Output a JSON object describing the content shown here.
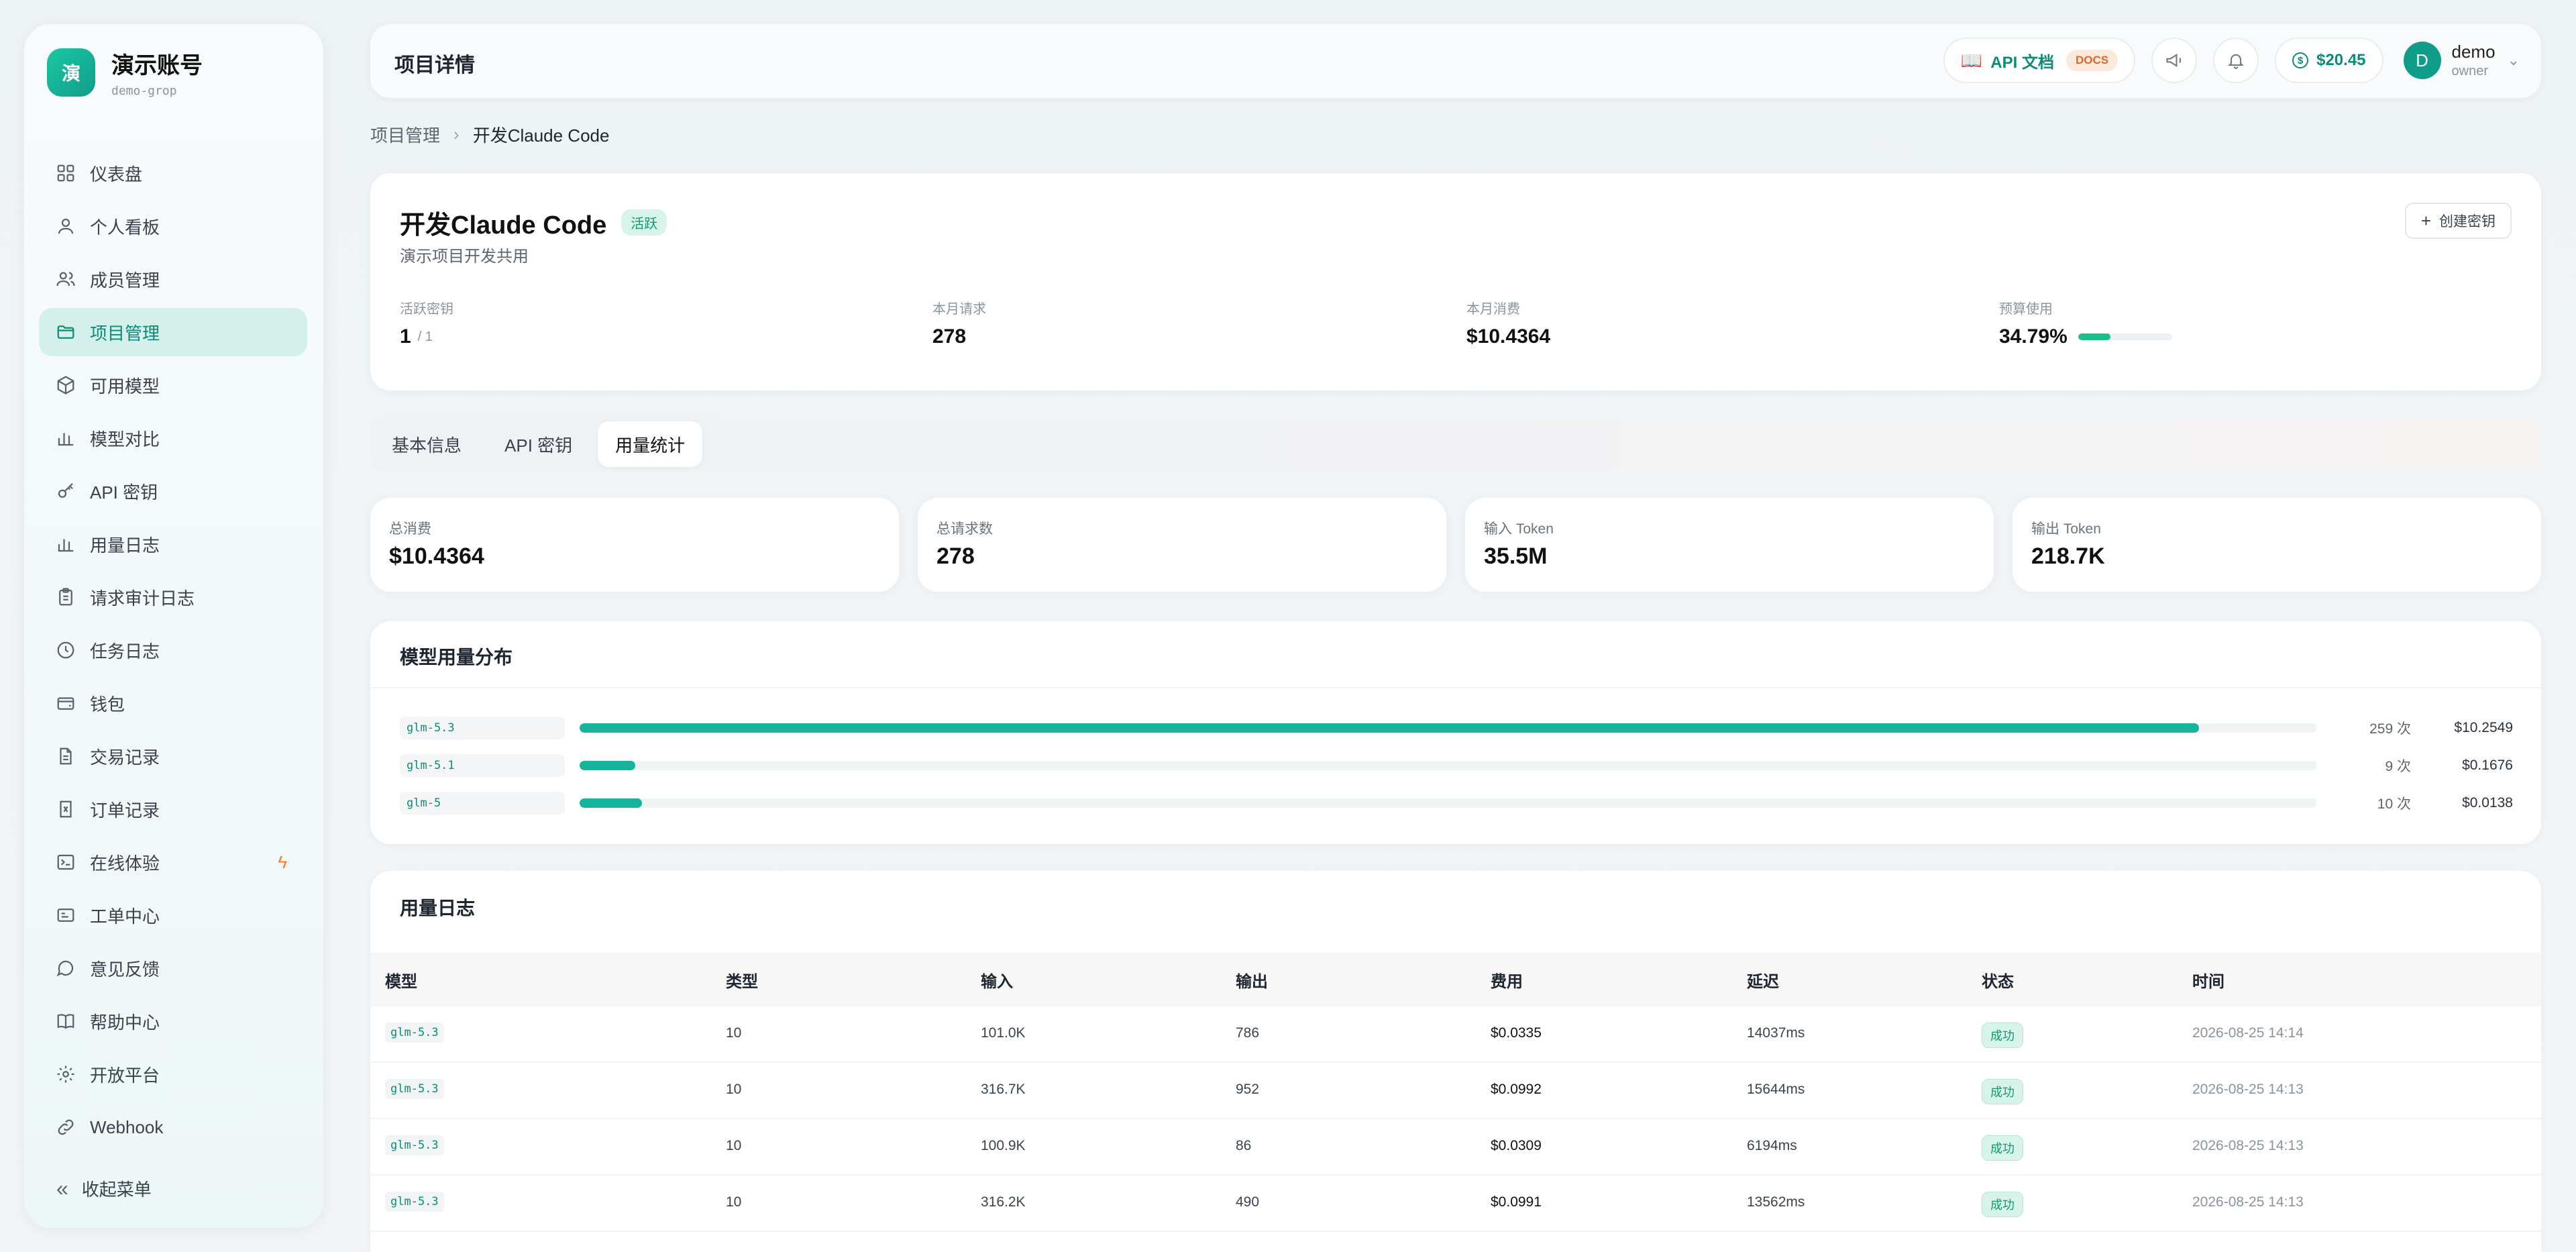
{
  "sidebar": {
    "logo_char": "演",
    "title": "演示账号",
    "subtitle": "demo-grop",
    "items": [
      {
        "label": "仪表盘",
        "icon": "dashboard-icon"
      },
      {
        "label": "个人看板",
        "icon": "user-icon"
      },
      {
        "label": "成员管理",
        "icon": "users-icon"
      },
      {
        "label": "项目管理",
        "icon": "folder-icon",
        "active": true
      },
      {
        "label": "可用模型",
        "icon": "cube-icon"
      },
      {
        "label": "模型对比",
        "icon": "bar-chart-icon"
      },
      {
        "label": "API 密钥",
        "icon": "key-icon"
      },
      {
        "label": "用量日志",
        "icon": "bar-chart-icon"
      },
      {
        "label": "请求审计日志",
        "icon": "clipboard-icon"
      },
      {
        "label": "任务日志",
        "icon": "clock-icon"
      },
      {
        "label": "钱包",
        "icon": "wallet-icon"
      },
      {
        "label": "交易记录",
        "icon": "document-icon"
      },
      {
        "label": "订单记录",
        "icon": "receipt-icon"
      },
      {
        "label": "在线体验",
        "icon": "terminal-icon"
      },
      {
        "label": "工单中心",
        "icon": "ticket-icon"
      },
      {
        "label": "意见反馈",
        "icon": "message-icon"
      },
      {
        "label": "帮助中心",
        "icon": "book-icon"
      },
      {
        "label": "开放平台",
        "icon": "gear-icon"
      },
      {
        "label": "Webhook",
        "icon": "link-icon"
      }
    ],
    "collapse_label": "收起菜单"
  },
  "header": {
    "title": "项目详情",
    "api_docs_label": "API 文档",
    "docs_badge": "DOCS",
    "balance": "$20.45",
    "user_initial": "D",
    "user_name": "demo",
    "user_role": "owner"
  },
  "breadcrumb": {
    "parent": "项目管理",
    "current": "开发Claude Code"
  },
  "project": {
    "name": "开发Claude Code",
    "status": "活跃",
    "description": "演示项目开发共用",
    "create_key_label": "创建密钥",
    "stats": {
      "active_keys_label": "活跃密钥",
      "active_keys": "1",
      "active_keys_total": "/ 1",
      "month_requests_label": "本月请求",
      "month_requests": "278",
      "month_cost_label": "本月消费",
      "month_cost": "$10.4364",
      "budget_label": "预算使用",
      "budget_value": "34.79%",
      "budget_fraction": 0.3479
    }
  },
  "tabs": [
    {
      "label": "基本信息"
    },
    {
      "label": "API 密钥"
    },
    {
      "label": "用量统计",
      "active": true
    }
  ],
  "metrics": [
    {
      "label": "总消费",
      "value": "$10.4364"
    },
    {
      "label": "总请求数",
      "value": "278"
    },
    {
      "label": "输入 Token",
      "value": "35.5M"
    },
    {
      "label": "输出 Token",
      "value": "218.7K"
    }
  ],
  "distribution": {
    "title": "模型用量分布",
    "rows": [
      {
        "model": "glm-5.3",
        "count": "259 次",
        "cost": "$10.2549",
        "fraction": 0.932
      },
      {
        "model": "glm-5.1",
        "count": "9 次",
        "cost": "$0.1676",
        "fraction": 0.032
      },
      {
        "model": "glm-5",
        "count": "10 次",
        "cost": "$0.0138",
        "fraction": 0.036
      }
    ]
  },
  "logs": {
    "title": "用量日志",
    "columns": [
      "模型",
      "类型",
      "输入",
      "输出",
      "费用",
      "延迟",
      "状态",
      "时间"
    ],
    "rows": [
      {
        "model": "glm-5.3",
        "type": "10",
        "input": "101.0K",
        "output": "786",
        "cost": "$0.0335",
        "latency": "14037ms",
        "status": "成功",
        "time": "2026-08-25 14:14"
      },
      {
        "model": "glm-5.3",
        "type": "10",
        "input": "316.7K",
        "output": "952",
        "cost": "$0.0992",
        "latency": "15644ms",
        "status": "成功",
        "time": "2026-08-25 14:13"
      },
      {
        "model": "glm-5.3",
        "type": "10",
        "input": "100.9K",
        "output": "86",
        "cost": "$0.0309",
        "latency": "6194ms",
        "status": "成功",
        "time": "2026-08-25 14:13"
      },
      {
        "model": "glm-5.3",
        "type": "10",
        "input": "316.2K",
        "output": "490",
        "cost": "$0.0991",
        "latency": "13562ms",
        "status": "成功",
        "time": "2026-08-25 14:13"
      }
    ]
  },
  "colors": {
    "accent": "#13b49a",
    "accent_dark": "#0c8c78",
    "success_bg": "#d8f4ea",
    "docs_badge": "#e0682a"
  }
}
